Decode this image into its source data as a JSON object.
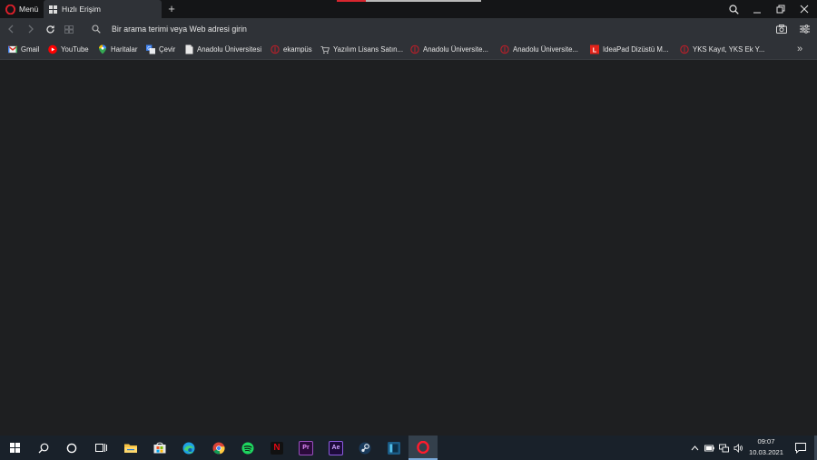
{
  "browser": {
    "menu_label": "Menü",
    "tab_title": "Hızlı Erişim",
    "new_tab_symbol": "+",
    "address_placeholder": "Bir arama terimi veya Web adresi girin"
  },
  "bookmarks": [
    {
      "label": "Gmail",
      "icon": "gmail-icon"
    },
    {
      "label": "YouTube",
      "icon": "youtube-icon"
    },
    {
      "label": "Haritalar",
      "icon": "maps-icon"
    },
    {
      "label": "Çevir",
      "icon": "translate-icon"
    },
    {
      "label": "Anadolu Üniversitesi",
      "icon": "page-icon"
    },
    {
      "label": "ekampüs",
      "icon": "anadolu-logo-icon"
    },
    {
      "label": "Yazılım Lisans Satın...",
      "icon": "cart-icon"
    },
    {
      "label": "Anadolu Üniversite...",
      "icon": "anadolu-logo-icon"
    },
    {
      "label": "Anadolu Üniversite...",
      "icon": "anadolu-logo-icon"
    },
    {
      "label": "IdeaPad Dizüstü M...",
      "icon": "lenovo-icon"
    },
    {
      "label": "YKS Kayıt, YKS Ek Y...",
      "icon": "anadolu-logo-icon"
    }
  ],
  "bookmarks_more": "»",
  "taskbar": {
    "apps": [
      "start",
      "search",
      "cortana",
      "task-view",
      "file-explorer",
      "store",
      "edge",
      "chrome",
      "spotify",
      "netflix",
      "premiere-pro",
      "after-effects",
      "steam",
      "app",
      "opera"
    ],
    "premiere_label": "Pr",
    "after_effects_label": "Ae",
    "netflix_label": "N",
    "time": "09:07",
    "date": "10.03.2021"
  },
  "colors": {
    "page_bg": "#1e1f21",
    "toolbar_bg": "#2f3237",
    "opera_red": "#d8262f",
    "taskbar_bg": "#19212a"
  }
}
